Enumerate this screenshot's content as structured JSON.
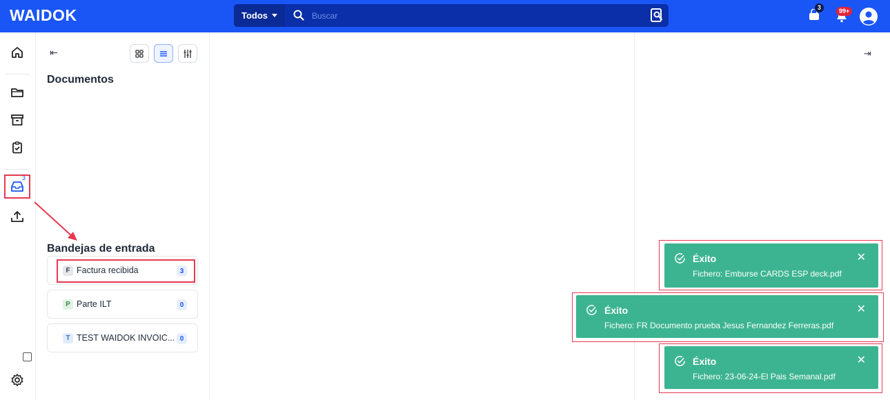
{
  "app": {
    "logo": "WAIDOK"
  },
  "search": {
    "scope": "Todos",
    "placeholder": "Buscar"
  },
  "header": {
    "cart_badge": "3",
    "notifications_badge": "99+"
  },
  "rail": {
    "inbox_badge": "3"
  },
  "panel": {
    "documents_title": "Documentos",
    "inboxes_title": "Bandejas de entrada",
    "inboxes": [
      {
        "letter": "F",
        "label": "Factura recibida",
        "count": "3",
        "letter_bg": "#e5e7eb",
        "letter_color": "#374151"
      },
      {
        "letter": "P",
        "label": "Parte ILT",
        "count": "0",
        "letter_bg": "#dff3e4",
        "letter_color": "#3b8a4f"
      },
      {
        "letter": "T",
        "label": "TEST WAIDOK INVOIC...",
        "count": "0",
        "letter_bg": "#e1ecfb",
        "letter_color": "#3f6fc2"
      }
    ]
  },
  "toasts": [
    {
      "title": "Éxito",
      "message": "Fichero: Emburse CARDS ESP deck.pdf"
    },
    {
      "title": "Éxito",
      "message": "Fichero: FR Documento prueba Jesus Fernandez Ferreras.pdf"
    },
    {
      "title": "Éxito",
      "message": "Fichero: 23-06-24-El Pais Semanal.pdf"
    }
  ],
  "colors": {
    "primary": "#1a56f5",
    "success": "#3db491",
    "annotation": "#e53950"
  }
}
